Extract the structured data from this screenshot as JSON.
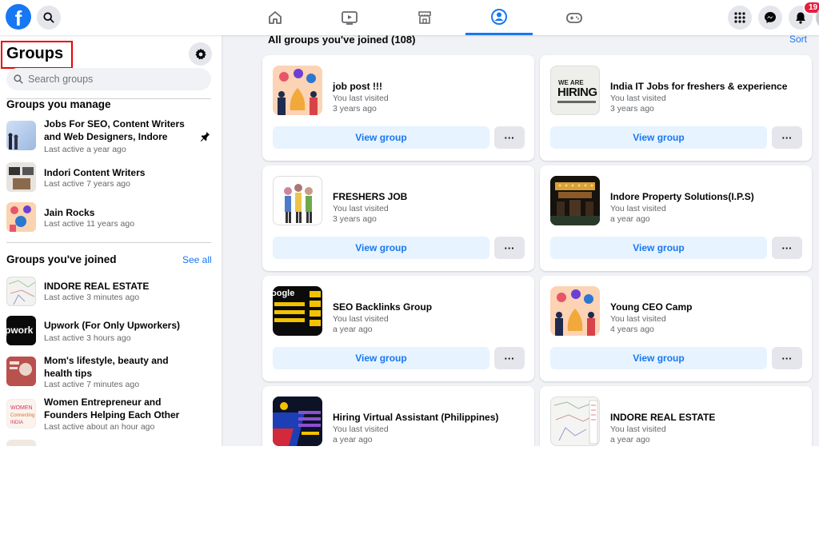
{
  "topbar": {
    "logo_letter": "f",
    "notification_count": "19"
  },
  "sidebar": {
    "title": "Groups",
    "search_placeholder": "Search groups",
    "manage_heading": "Groups you manage",
    "joined_heading": "Groups you've joined",
    "see_all": "See all",
    "managed": [
      {
        "name": "Jobs For SEO, Content Writers and Web Designers, Indore",
        "sub": "Last active a year ago"
      },
      {
        "name": "Indori Content Writers",
        "sub": "Last active 7 years ago"
      },
      {
        "name": "Jain Rocks",
        "sub": "Last active 11 years ago"
      }
    ],
    "joined": [
      {
        "name": "INDORE REAL ESTATE",
        "sub": "Last active 3 minutes ago"
      },
      {
        "name": "Upwork (For Only Upworkers)",
        "sub": "Last active 3 hours ago"
      },
      {
        "name": "Mom's lifestyle, beauty and health tips",
        "sub": "Last active 7 minutes ago"
      },
      {
        "name": "Women Entrepreneur and Founders Helping Each Other",
        "sub": "Last active about an hour ago"
      }
    ]
  },
  "main": {
    "heading": "All groups you've joined (108)",
    "sort": "Sort",
    "view_label": "View group",
    "more_label": "···",
    "cards": [
      {
        "name": "job post !!!",
        "sub1": "You last visited",
        "sub2": "3 years ago"
      },
      {
        "name": "India IT Jobs for freshers & experience",
        "sub1": "You last visited",
        "sub2": "3 years ago"
      },
      {
        "name": "FRESHERS JOB",
        "sub1": "You last visited",
        "sub2": "3 years ago"
      },
      {
        "name": "Indore Property Solutions(I.P.S)",
        "sub1": "You last visited",
        "sub2": "a year ago"
      },
      {
        "name": "SEO Backlinks Group",
        "sub1": "You last visited",
        "sub2": "a year ago"
      },
      {
        "name": "Young CEO Camp",
        "sub1": "You last visited",
        "sub2": "4 years ago"
      },
      {
        "name": "Hiring Virtual Assistant (Philippines)",
        "sub1": "You last visited",
        "sub2": "a year ago"
      },
      {
        "name": "INDORE REAL ESTATE",
        "sub1": "You last visited",
        "sub2": "a year ago"
      }
    ]
  },
  "thumb_text": {
    "hiring_line1": "WE ARE",
    "hiring_line2": "HIRING",
    "upwork": "pwork",
    "google": "oogle"
  }
}
